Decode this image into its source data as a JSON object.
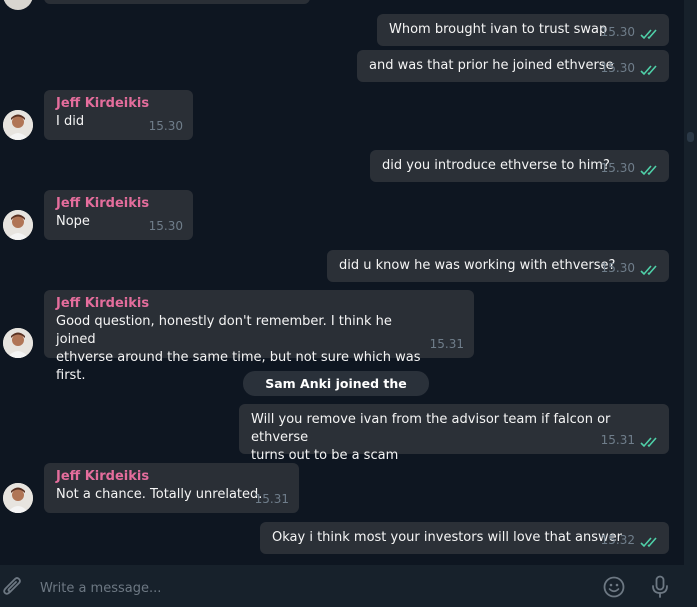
{
  "messages": [
    {
      "type": "out",
      "text": "Whom brought ivan to trust swap",
      "time": "15.30"
    },
    {
      "type": "out",
      "text": "and was that prior he joined ethverse",
      "time": "15.30"
    },
    {
      "type": "in",
      "sender": "Jeff Kirdeikis",
      "text": "I did",
      "time": "15.30"
    },
    {
      "type": "out",
      "text": "did you introduce ethverse to him?",
      "time": "15.30"
    },
    {
      "type": "in",
      "sender": "Jeff Kirdeikis",
      "text": "Nope",
      "time": "15.30"
    },
    {
      "type": "out",
      "text": "did u know he was working with ethverse?",
      "time": "15.30"
    },
    {
      "type": "in",
      "sender": "Jeff Kirdeikis",
      "text": "Good question, honestly don't remember. I think he joined\nethverse around the same time, but not sure which was first.",
      "time": "15.31"
    },
    {
      "type": "service",
      "text": "Sam Anki joined the group"
    },
    {
      "type": "out",
      "text": "Will you remove ivan from the advisor team if falcon or ethverse\nturns out to be a scam",
      "time": "15.31"
    },
    {
      "type": "in",
      "sender": "Jeff Kirdeikis",
      "text": "Not a chance. Totally unrelated.",
      "time": "15.31"
    },
    {
      "type": "out",
      "text": "Okay i think most your investors will love that answer",
      "time": "15.32"
    }
  ],
  "composer": {
    "placeholder": "Write a message..."
  },
  "icons": {
    "attach": "paperclip-icon",
    "emoji": "emoji-icon",
    "voice": "microphone-icon",
    "read": "double-check-icon"
  },
  "colors": {
    "chat_bg": "#0e1621",
    "panel_bg": "#17212b",
    "bubble": "#2a2f36",
    "sender": "#e46d9c",
    "check": "#4fd0a8",
    "time": "#6f7d8a"
  }
}
